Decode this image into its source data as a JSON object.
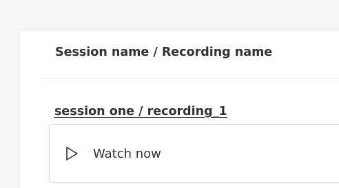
{
  "table": {
    "column_header": "Session name / Recording name"
  },
  "recordings": [
    {
      "title": "session one / recording_1",
      "action_label": "Watch now",
      "action_icon": "play-outline-icon"
    }
  ]
}
